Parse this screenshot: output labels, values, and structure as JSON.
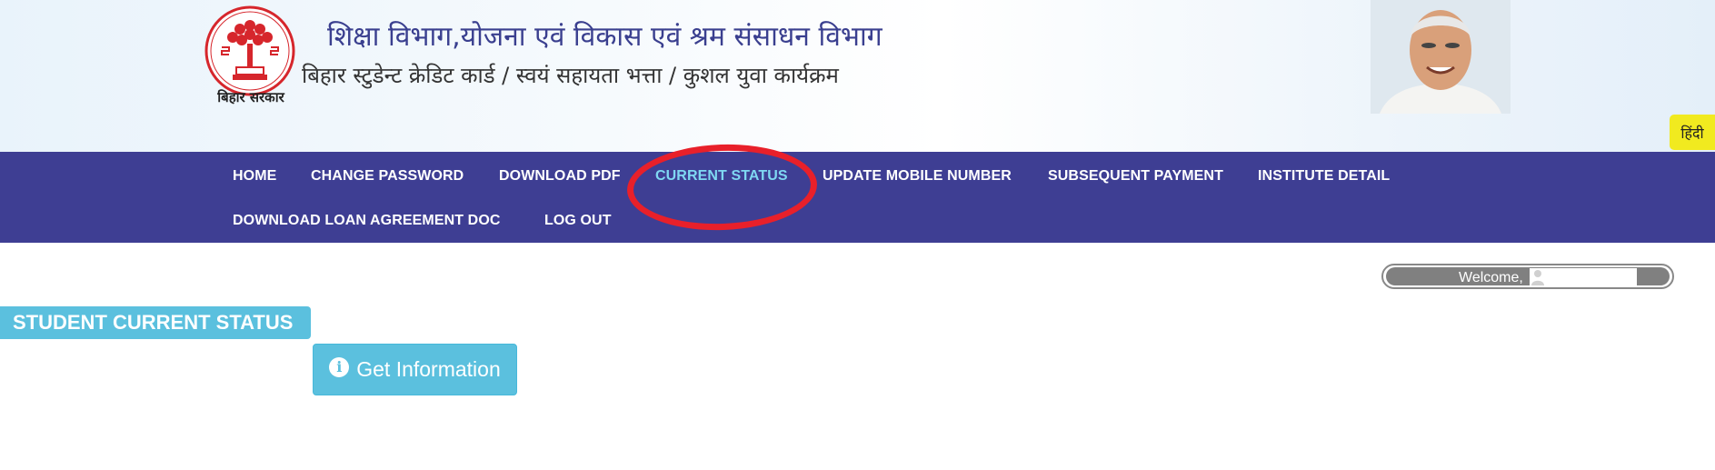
{
  "header": {
    "logo_caption": "बिहार सरकार",
    "title_main": "शिक्षा विभाग,योजना एवं विकास एवं श्रम संसाधन विभाग",
    "title_sub": "बिहार स्टुडेन्ट क्रेडिट कार्ड / स्वयं सहायता भत्ता / कुशल युवा कार्यक्रम",
    "language_toggle": "हिंदी"
  },
  "nav": {
    "items": [
      {
        "label": "HOME"
      },
      {
        "label": "CHANGE PASSWORD"
      },
      {
        "label": "DOWNLOAD PDF"
      },
      {
        "label": "CURRENT STATUS",
        "active": true
      },
      {
        "label": "UPDATE MOBILE NUMBER"
      },
      {
        "label": "SUBSEQUENT PAYMENT"
      },
      {
        "label": "INSTITUTE DETAIL"
      },
      {
        "label": "DOWNLOAD LOAN AGREEMENT DOC"
      },
      {
        "label": "LOG OUT"
      }
    ]
  },
  "welcome": {
    "text": "Welcome,"
  },
  "main": {
    "section_title": "STUDENT CURRENT STATUS",
    "get_info_label": "Get Information",
    "get_info_icon": "info-circle-icon"
  },
  "colors": {
    "nav_bg": "#3e3e93",
    "active_nav": "#7fd8f2",
    "info_button": "#5bc0de",
    "highlight_ring": "#e8202a",
    "language_button": "#f1ea1f"
  }
}
